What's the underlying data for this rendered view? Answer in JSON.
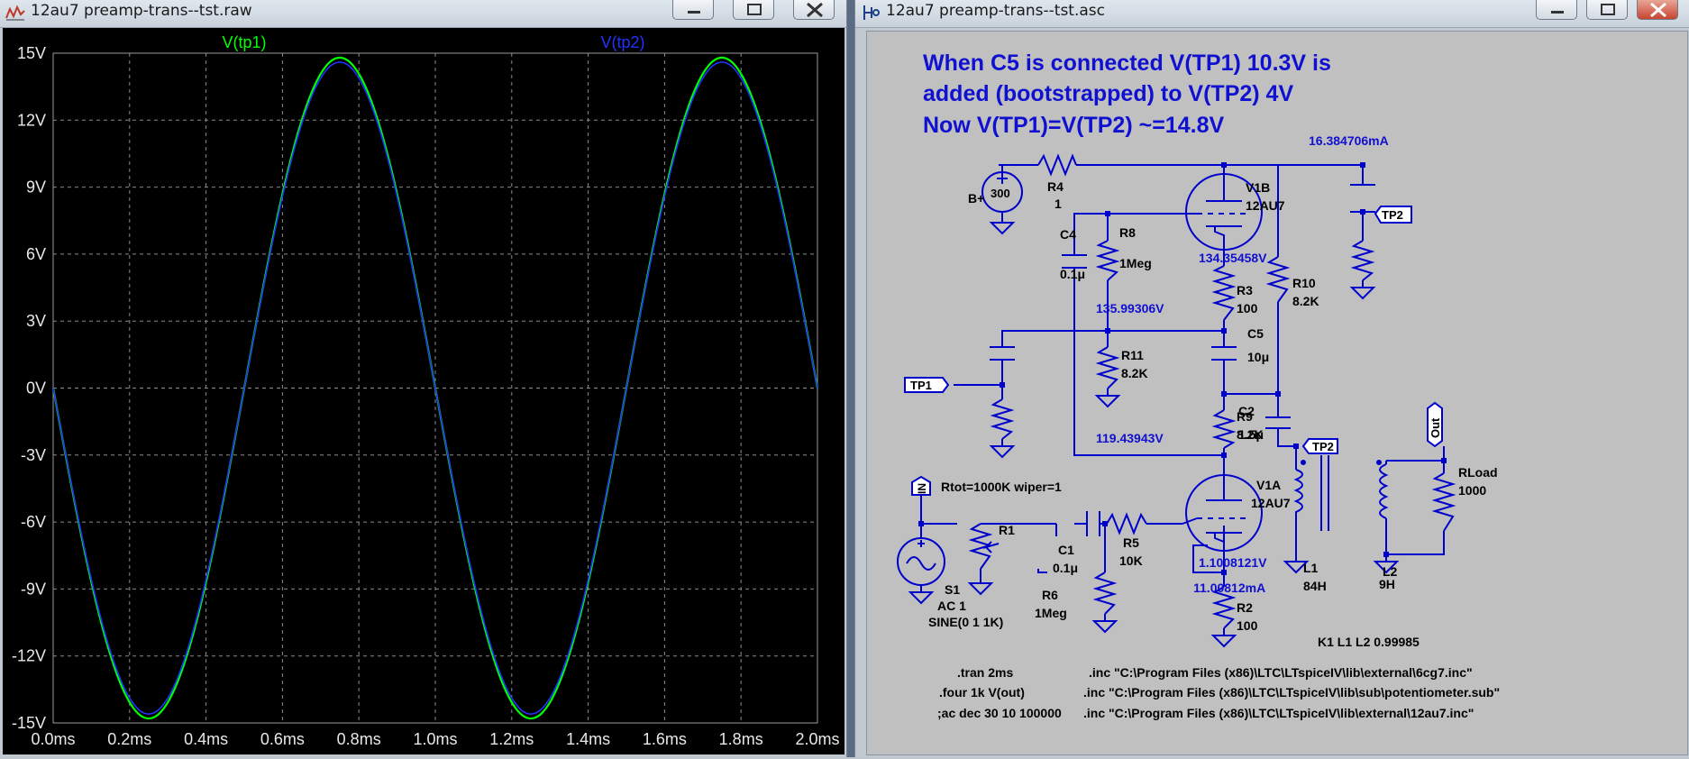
{
  "left_window": {
    "title": "12au7 preamp-trans--tst.raw",
    "buttons": {
      "minimize": "minimize",
      "maximize": "maximize",
      "close": "close"
    }
  },
  "right_window": {
    "title": "12au7 preamp-trans--tst.asc",
    "buttons": {
      "minimize": "minimize",
      "maximize": "maximize",
      "close": "close"
    }
  },
  "colors": {
    "tp1": "#00ff00",
    "tp2": "#2233ff",
    "schematic": "#0000cc",
    "grid": "#8a8a8a",
    "plot_bg": "#000000"
  },
  "chart_data": {
    "type": "line",
    "title": "",
    "xlabel": "",
    "ylabel": "",
    "xlim": [
      0,
      2
    ],
    "ylim": [
      -15,
      15
    ],
    "x_unit": "ms",
    "x_ticks": [
      "0.0ms",
      "0.2ms",
      "0.4ms",
      "0.6ms",
      "0.8ms",
      "1.0ms",
      "1.2ms",
      "1.4ms",
      "1.6ms",
      "1.8ms",
      "2.0ms"
    ],
    "y_ticks": [
      "15V",
      "12V",
      "9V",
      "6V",
      "3V",
      "0V",
      "-3V",
      "-6V",
      "-9V",
      "-12V",
      "-15V"
    ],
    "legend": "top",
    "grid": true,
    "series": [
      {
        "name": "V(tp1)",
        "color": "#00ff00",
        "amplitude": 14.8,
        "freq_khz": 1,
        "phase": "negative-sine"
      },
      {
        "name": "V(tp2)",
        "color": "#2233ff",
        "amplitude": 14.6,
        "freq_khz": 1,
        "phase": "negative-sine"
      }
    ]
  },
  "schematic": {
    "comment_lines": [
      "When C5 is connected V(TP1) 10.3V is",
      "added (bootstrapped) to V(TP2) 4V",
      "Now V(TP1)=V(TP2) ~=14.8V"
    ],
    "labels": {
      "i_top": "16.384706mA",
      "b_plus": "B+",
      "v300": "300",
      "r4": "R4",
      "r4_val": "1",
      "v1b": "V1B",
      "v1b_val": "12AU7",
      "tp2_top": "TP2",
      "c4": "C4",
      "c4_val": "0.1μ",
      "r8": "R8",
      "r8_val": "1Meg",
      "v134": "134.35458V",
      "r10": "R10",
      "r10_val": "8.2K",
      "r3": "R3",
      "r3_val": "100",
      "v135": "135.99306V",
      "c5": "C5",
      "c5_val": "10μ",
      "r11": "R11",
      "r11_val": "8.2K",
      "tp1": "TP1",
      "c2": "C2",
      "c2_val": "1.5μ",
      "r9": "R9",
      "r9_val": "8.2K",
      "v119": "119.43943V",
      "tp2_mid": "TP2",
      "out": "Out",
      "rload": "RLoad",
      "rload_val": "1000",
      "in": "IN",
      "rtot": "Rtot=1000K wiper=1",
      "v1a": "V1A",
      "v1a_val": "12AU7",
      "r1": "R1",
      "c1": "C1",
      "c1_val": "0.1μ",
      "r5": "R5",
      "r5_val": "10K",
      "v1_10": "1.1008121V",
      "i_11": "11.00812mA",
      "s1": "S1",
      "s1_ac": "AC 1",
      "s1_sine": "SINE(0 1 1K)",
      "r6": "R6",
      "r6_val": "1Meg",
      "r2": "R2",
      "r2_val": "100",
      "l1": "L1",
      "l1_val": "84H",
      "l2": "L2",
      "l2_val": "9H",
      "k1": "K1 L1 L2 0.99985"
    },
    "directives": {
      "tran": ".tran 2ms",
      "four": ".four 1k V(out)",
      "ac": ";ac dec 30 10 100000",
      "inc1": ".inc \"C:\\Program Files (x86)\\LTC\\LTspiceIV\\lib\\external\\6cg7.inc\"",
      "inc2": ".inc \"C:\\Program Files (x86)\\LTC\\LTspiceIV\\lib\\sub\\potentiometer.sub\"",
      "inc3": ".inc \"C:\\Program Files (x86)\\LTC\\LTspiceIV\\lib\\external\\12au7.inc\""
    }
  }
}
